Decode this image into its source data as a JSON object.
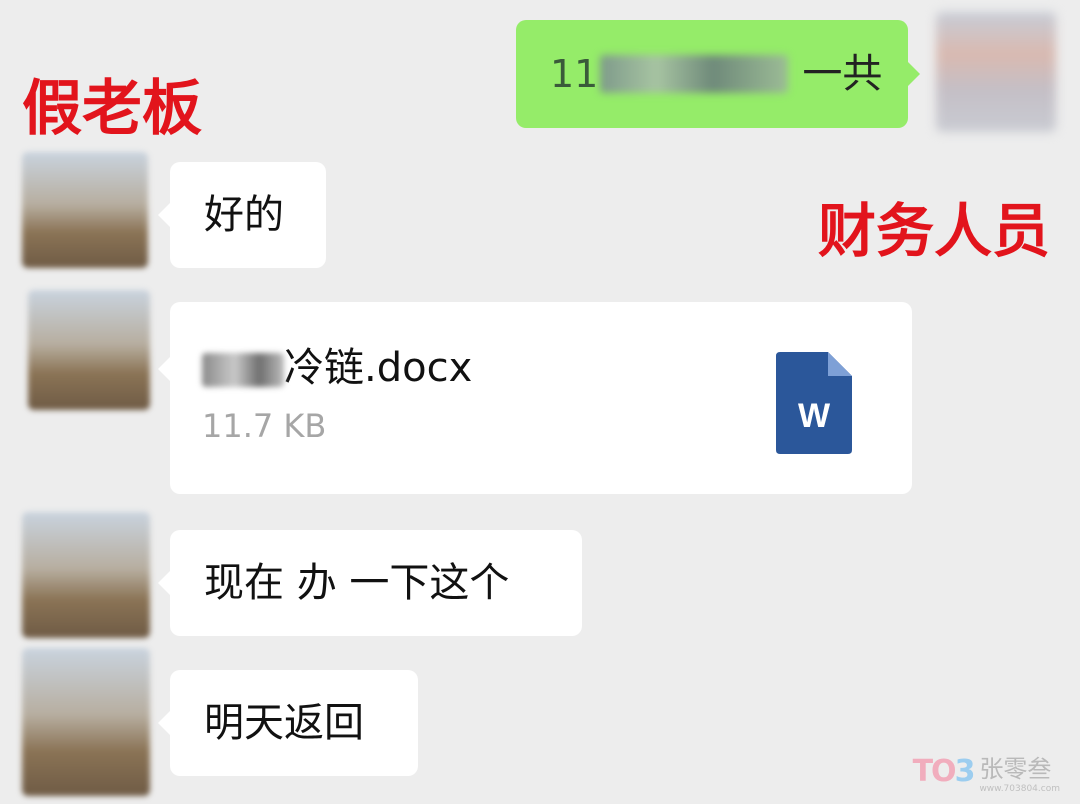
{
  "labels": {
    "fake_boss": "假老板",
    "finance_staff": "财务人员"
  },
  "messages": [
    {
      "side": "right",
      "prefix": "11",
      "suffix": "一共"
    },
    {
      "side": "left",
      "text": "好的"
    },
    {
      "side": "left",
      "type": "file",
      "file_name": "冷链.docx",
      "file_size": "11.7 KB",
      "file_icon_letter": "W"
    },
    {
      "side": "left",
      "text": "现在 办 一下这个"
    },
    {
      "side": "left",
      "text": "明天返回"
    }
  ],
  "watermark": {
    "logo_a": "TO",
    "logo_b": "3",
    "name": "张零叁",
    "url": "www.703804.com"
  },
  "colors": {
    "background": "#ededed",
    "self_bubble": "#95ec69",
    "other_bubble": "#ffffff",
    "label_red": "#e2141c",
    "word_blue": "#2b579a"
  }
}
